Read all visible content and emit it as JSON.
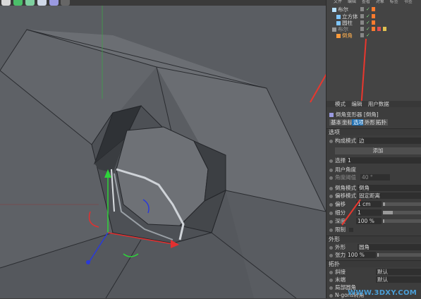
{
  "menu": {
    "items": [
      "文件",
      "编辑",
      "查看",
      "对象",
      "标签",
      "书签"
    ]
  },
  "objects": [
    {
      "name": "布尔",
      "color": "#b5e0ff",
      "tags": [
        "#ff7b2e"
      ]
    },
    {
      "name": "立方体",
      "color": "#7fc6ff",
      "tags": [
        "#ff7b2e"
      ]
    },
    {
      "name": "圆柱",
      "color": "#7fc6ff",
      "tags": [
        "#ff7b2e"
      ]
    },
    {
      "name": "布尔",
      "color": "#9a9a9a",
      "tags": [
        "#ff7b2e",
        "#e05050",
        "#e0c050"
      ]
    },
    {
      "name": "倒角",
      "color": "#ff9a3a",
      "tags": []
    }
  ],
  "attributes": {
    "menu": [
      "模式",
      "编辑",
      "用户数据"
    ],
    "object_title": "倒角变形器 [倒角]",
    "tabs": [
      "基本",
      "坐标",
      "选项",
      "外形",
      "拓扑"
    ],
    "active_tab": "选项",
    "options_header": "选项",
    "build_mode_label": "构成模式",
    "build_mode_value": "边",
    "add_button": "添加",
    "selection_label": "选择",
    "selection_value": "1",
    "user_angle_label": "用户角度",
    "angle_threshold_label": "角度阈值",
    "angle_threshold_value": "40 °",
    "bevel_mode_label": "倒角模式",
    "bevel_mode_value": "倒角",
    "offset_mode_label": "偏移模式",
    "offset_mode_value": "固定距离",
    "offset_label": "偏移",
    "offset_value": "1 cm",
    "subdivision_label": "细分",
    "subdivision_value": "1",
    "depth_label": "深度",
    "depth_value": "100 %",
    "limit_label": "限制",
    "shape_header": "外形",
    "shape_label": "外形",
    "shape_value": "圆角",
    "tension_label": "张力",
    "tension_value": "100 %",
    "topology_header": "拓扑",
    "miter_label": "斜接",
    "miter_value": "默认",
    "end_label": "末端",
    "end_value": "默认",
    "partial_label": "局部圆角",
    "ngons_label": "N-gons转角"
  },
  "accent": "#1e6fb3",
  "annotation_color": "#e8372e",
  "watermark": "WWW.3DXY.COM"
}
